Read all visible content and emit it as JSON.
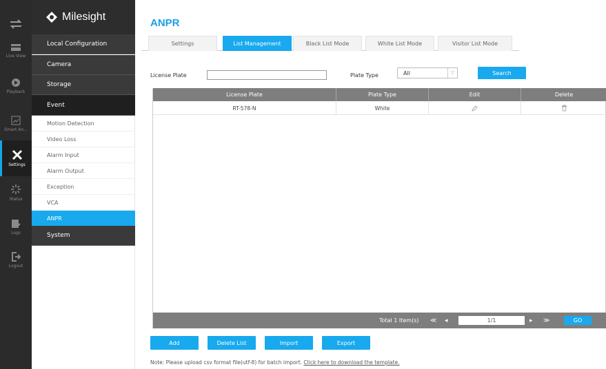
{
  "brand": {
    "name": "Milesight"
  },
  "rail": [
    {
      "key": "toggle",
      "label": ""
    },
    {
      "key": "live-view",
      "label": "Live View"
    },
    {
      "key": "playback",
      "label": "Playback"
    },
    {
      "key": "smart-analytics",
      "label": "Smart An..."
    },
    {
      "key": "settings",
      "label": "Settings"
    },
    {
      "key": "status",
      "label": "Status"
    },
    {
      "key": "logs",
      "label": "Logs"
    },
    {
      "key": "logout",
      "label": "Logout"
    }
  ],
  "menu": {
    "local_configuration": "Local Configuration",
    "camera": "Camera",
    "storage": "Storage",
    "event": "Event",
    "sub": [
      "Motion Detection",
      "Video Loss",
      "Alarm Input",
      "Alarm Output",
      "Exception",
      "VCA",
      "ANPR"
    ],
    "system": "System"
  },
  "page": {
    "title": "ANPR"
  },
  "tabs": [
    "Settings",
    "List Management",
    "Black List Mode",
    "White List Mode",
    "Visitor List Mode"
  ],
  "filter": {
    "license_plate_label": "License Plate",
    "license_plate_value": "",
    "plate_type_label": "Plate Type",
    "plate_type_value": "All",
    "search_label": "Search"
  },
  "table": {
    "columns": [
      "License Plate",
      "Plate Type",
      "Edit",
      "Delete"
    ],
    "rows": [
      {
        "license_plate": "RT-578-N",
        "plate_type": "White"
      }
    ],
    "total_text": "Total 1 Item(s)",
    "page_value": "1/1",
    "go_label": "GO"
  },
  "actions": {
    "add": "Add",
    "delete_list": "Delete List",
    "import": "Import",
    "export": "Export"
  },
  "note": {
    "text": "Note: Please upload csv format file(utf-8) for batch import. ",
    "link": "Click here to download the template."
  },
  "colors": {
    "accent": "#18a9ee",
    "rail_bg": "#2b2b2b",
    "header_bg": "#7e7e7e"
  }
}
